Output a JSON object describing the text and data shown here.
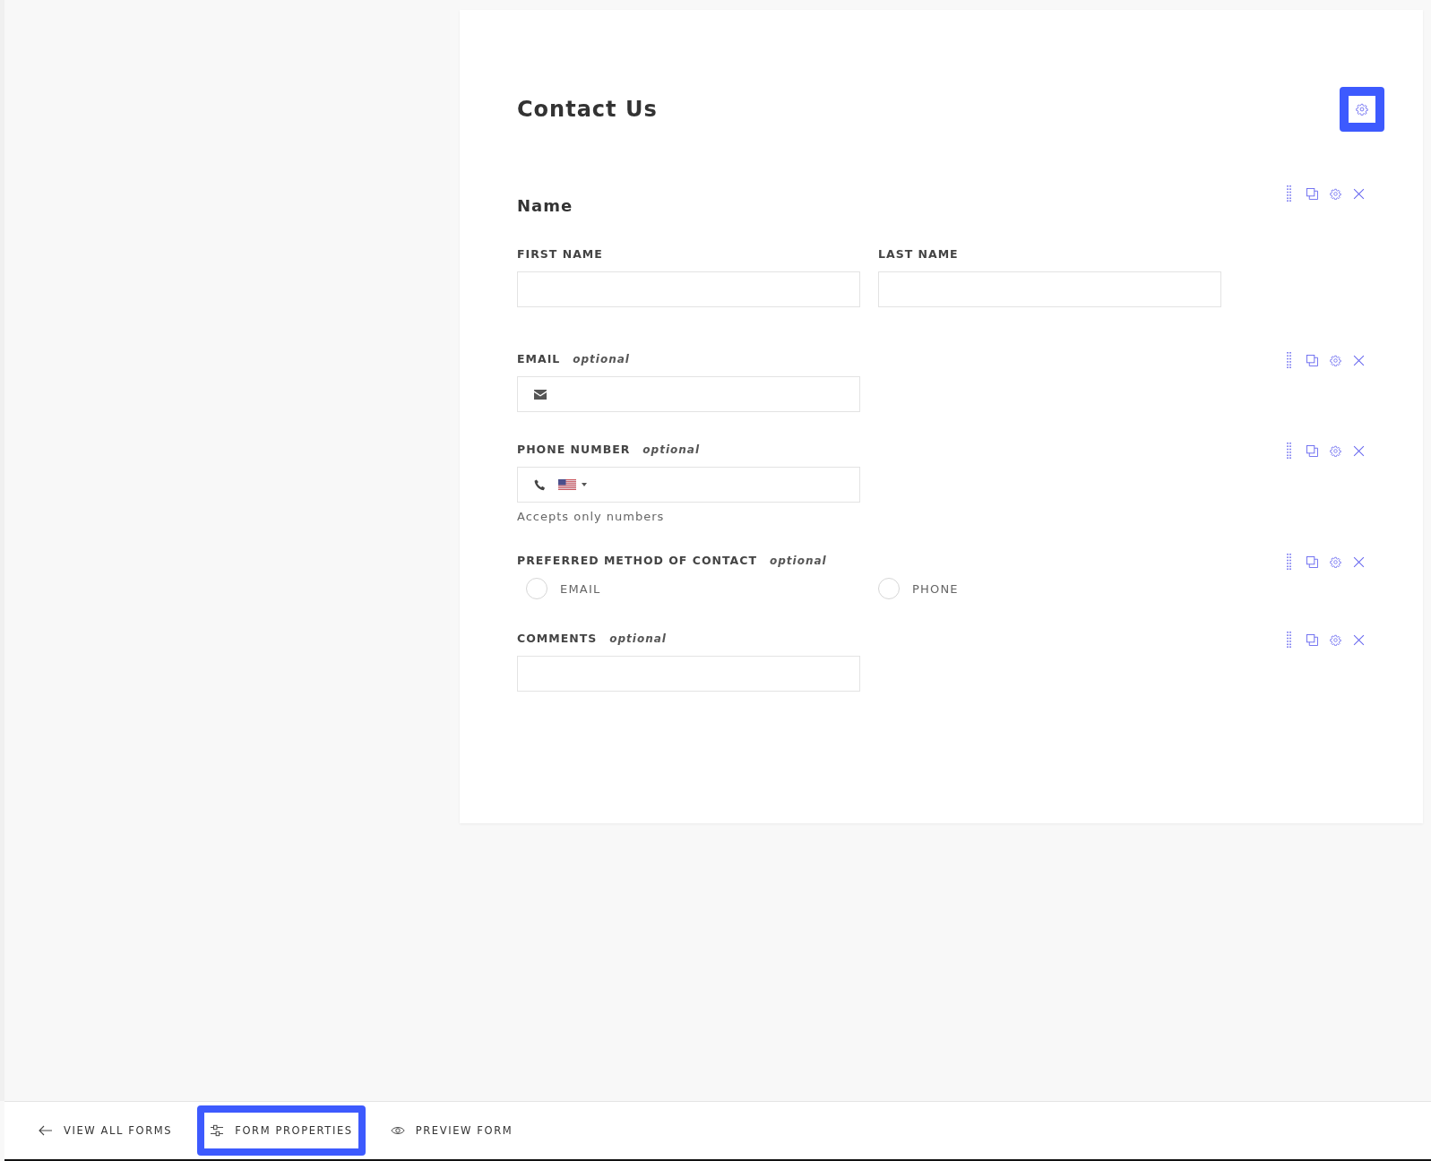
{
  "form": {
    "title": "Contact Us",
    "fields": [
      {
        "kind": "group",
        "heading": "Name",
        "subfields": [
          {
            "label": "FIRST NAME"
          },
          {
            "label": "LAST NAME"
          }
        ]
      },
      {
        "kind": "email",
        "label": "EMAIL",
        "tag": "optional"
      },
      {
        "kind": "phone",
        "label": "PHONE NUMBER",
        "tag": "optional",
        "hint": "Accepts only numbers"
      },
      {
        "kind": "radio",
        "label": "PREFERRED METHOD OF CONTACT",
        "tag": "optional",
        "options": [
          {
            "label": "EMAIL",
            "selected": false
          },
          {
            "label": "PHONE",
            "selected": false
          }
        ]
      },
      {
        "kind": "text",
        "label": "COMMENTS",
        "tag": "optional"
      }
    ]
  },
  "bottom_bar": {
    "items": [
      {
        "kind": "back",
        "label": "VIEW ALL FORMS",
        "selected": false
      },
      {
        "kind": "properties",
        "label": "FORM PROPERTIES",
        "selected": true
      },
      {
        "kind": "preview",
        "label": "PREVIEW FORM",
        "selected": false
      }
    ]
  }
}
